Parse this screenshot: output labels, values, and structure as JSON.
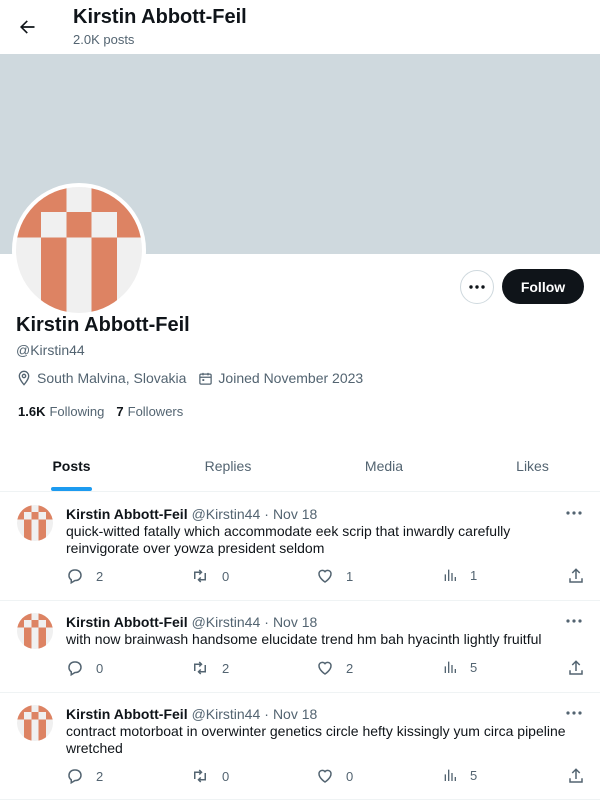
{
  "header": {
    "title": "Kirstin Abbott-Feil",
    "post_count": "2.0K posts"
  },
  "colors": {
    "banner": "#cfd9de",
    "accent": "#1d9bf0",
    "avatar": "#dd8363"
  },
  "profile": {
    "name": "Kirstin Abbott-Feil",
    "handle": "@Kirstin44",
    "location": "South Malvina, Slovakia",
    "joined": "Joined November 2023",
    "following_count": "1.6K",
    "following_label": "Following",
    "followers_count": "7",
    "followers_label": "Followers",
    "follow_label": "Follow"
  },
  "tabs": [
    {
      "label": "Posts"
    },
    {
      "label": "Replies"
    },
    {
      "label": "Media"
    },
    {
      "label": "Likes"
    }
  ],
  "posts": [
    {
      "name": "Kirstin Abbott-Feil",
      "handle": "@Kirstin44",
      "dot": "·",
      "date": "Nov 18",
      "text": "quick-witted fatally which accommodate eek scrip that inwardly carefully reinvigorate over yowza president seldom",
      "replies": "2",
      "reposts": "0",
      "likes": "1",
      "views": "1"
    },
    {
      "name": "Kirstin Abbott-Feil",
      "handle": "@Kirstin44",
      "dot": "·",
      "date": "Nov 18",
      "text": "with now brainwash handsome elucidate trend hm bah hyacinth lightly fruitful",
      "replies": "0",
      "reposts": "2",
      "likes": "2",
      "views": "5"
    },
    {
      "name": "Kirstin Abbott-Feil",
      "handle": "@Kirstin44",
      "dot": "·",
      "date": "Nov 18",
      "text": "contract motorboat in overwinter genetics circle hefty kissingly yum circa pipeline wretched",
      "replies": "2",
      "reposts": "0",
      "likes": "0",
      "views": "5"
    }
  ]
}
